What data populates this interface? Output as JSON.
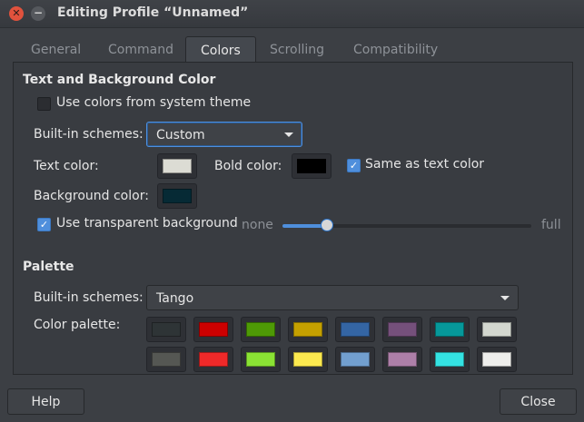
{
  "window": {
    "title": "Editing Profile “Unnamed”",
    "close_glyph": "✕",
    "minimize_glyph": "−"
  },
  "tabs": [
    {
      "label": "General",
      "active": false
    },
    {
      "label": "Command",
      "active": false
    },
    {
      "label": "Colors",
      "active": true
    },
    {
      "label": "Scrolling",
      "active": false
    },
    {
      "label": "Compatibility",
      "active": false
    }
  ],
  "text_bg": {
    "section_title": "Text and Background Color",
    "use_system_colors_label": "Use colors from system theme",
    "use_system_colors_checked": false,
    "builtin_schemes_label": "Built-in schemes:",
    "builtin_schemes_value": "Custom",
    "text_color_label": "Text color:",
    "text_color": "#dcdcd4",
    "bold_color_label": "Bold color:",
    "bold_color": "#000000",
    "same_as_text_label": "Same as text color",
    "same_as_text_checked": true,
    "background_color_label": "Background color:",
    "background_color": "#062a35",
    "transparent_label": "Use transparent background",
    "transparent_checked": true,
    "transparency_min_label": "none",
    "transparency_max_label": "full",
    "transparency_level": 0.18
  },
  "palette": {
    "section_title": "Palette",
    "builtin_schemes_label": "Built-in schemes:",
    "builtin_schemes_value": "Tango",
    "color_palette_label": "Color palette:",
    "row1": [
      "#2e3436",
      "#cc0000",
      "#4e9a06",
      "#c4a000",
      "#3465a4",
      "#75507b",
      "#06989a",
      "#d3d7cf"
    ],
    "row2": [
      "#555753",
      "#ef2929",
      "#8ae234",
      "#fce94f",
      "#729fcf",
      "#ad7fa8",
      "#34e2e2",
      "#eeeeec"
    ]
  },
  "buttons": {
    "help": "Help",
    "close": "Close"
  },
  "check_glyph": "✓"
}
